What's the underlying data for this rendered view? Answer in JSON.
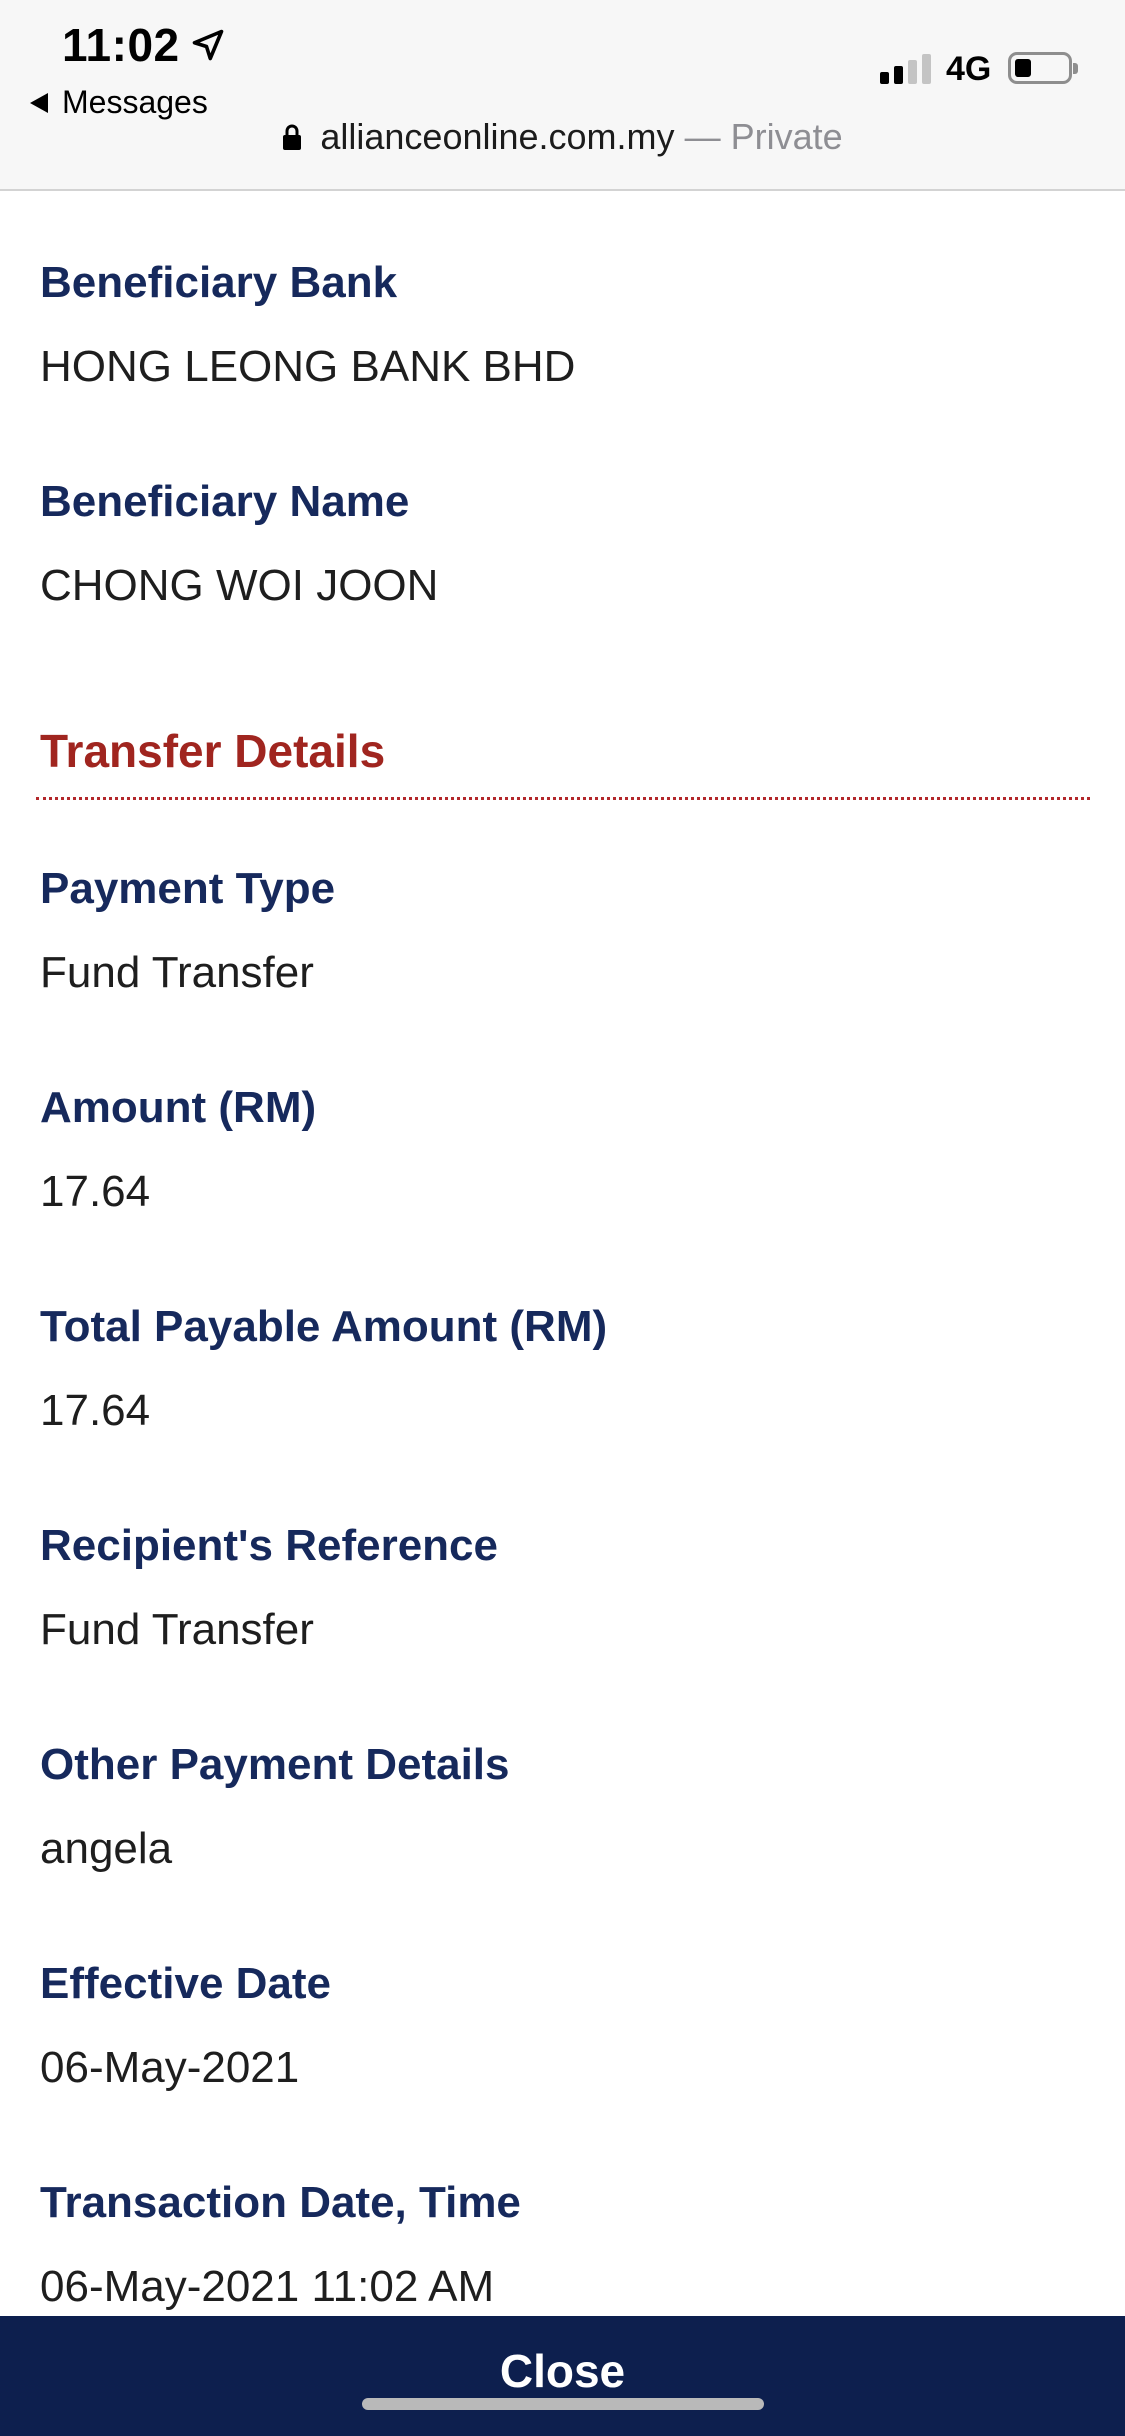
{
  "status_bar": {
    "time": "11:02",
    "back_label": "Messages",
    "network": "4G",
    "signal_bars_filled": 2,
    "signal_bars_total": 4,
    "battery_level": 0.25
  },
  "browser": {
    "domain": "allianceonline.com.my",
    "mode": "— Private"
  },
  "beneficiary": {
    "bank_label": "Beneficiary Bank",
    "bank_value": "HONG LEONG BANK BHD",
    "name_label": "Beneficiary Name",
    "name_value": "CHONG WOI JOON"
  },
  "transfer": {
    "section_title": "Transfer Details",
    "fields": [
      {
        "label": "Payment Type",
        "value": "Fund Transfer"
      },
      {
        "label": "Amount (RM)",
        "value": "17.64"
      },
      {
        "label": "Total Payable Amount (RM)",
        "value": "17.64"
      },
      {
        "label": "Recipient's Reference",
        "value": "Fund Transfer"
      },
      {
        "label": "Other Payment Details",
        "value": "angela"
      },
      {
        "label": "Effective Date",
        "value": "06-May-2021"
      },
      {
        "label": "Transaction Date, Time",
        "value": "06-May-2021 11:02 AM"
      }
    ]
  },
  "footer": {
    "close_label": "Close"
  },
  "colors": {
    "label": "#16295c",
    "section": "#a0251f",
    "footer_bg": "#0d1f4e"
  }
}
